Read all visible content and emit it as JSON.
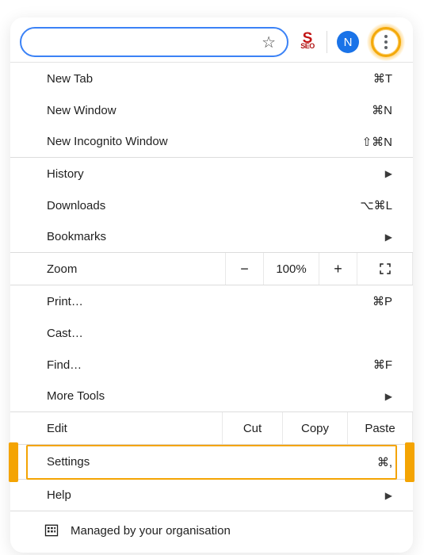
{
  "toolbar": {
    "profile_initial": "N"
  },
  "menu": {
    "new_tab": {
      "label": "New Tab",
      "shortcut": "⌘T"
    },
    "new_window": {
      "label": "New Window",
      "shortcut": "⌘N"
    },
    "new_incognito": {
      "label": "New Incognito Window",
      "shortcut": "⇧⌘N"
    },
    "history": {
      "label": "History"
    },
    "downloads": {
      "label": "Downloads",
      "shortcut": "⌥⌘L"
    },
    "bookmarks": {
      "label": "Bookmarks"
    },
    "zoom": {
      "label": "Zoom",
      "value": "100%"
    },
    "print": {
      "label": "Print…",
      "shortcut": "⌘P"
    },
    "cast": {
      "label": "Cast…"
    },
    "find": {
      "label": "Find…",
      "shortcut": "⌘F"
    },
    "more_tools": {
      "label": "More Tools"
    },
    "edit": {
      "label": "Edit",
      "cut": "Cut",
      "copy": "Copy",
      "paste": "Paste"
    },
    "settings": {
      "label": "Settings",
      "shortcut": "⌘,"
    },
    "help": {
      "label": "Help"
    },
    "managed": {
      "label": "Managed by your organisation"
    }
  }
}
